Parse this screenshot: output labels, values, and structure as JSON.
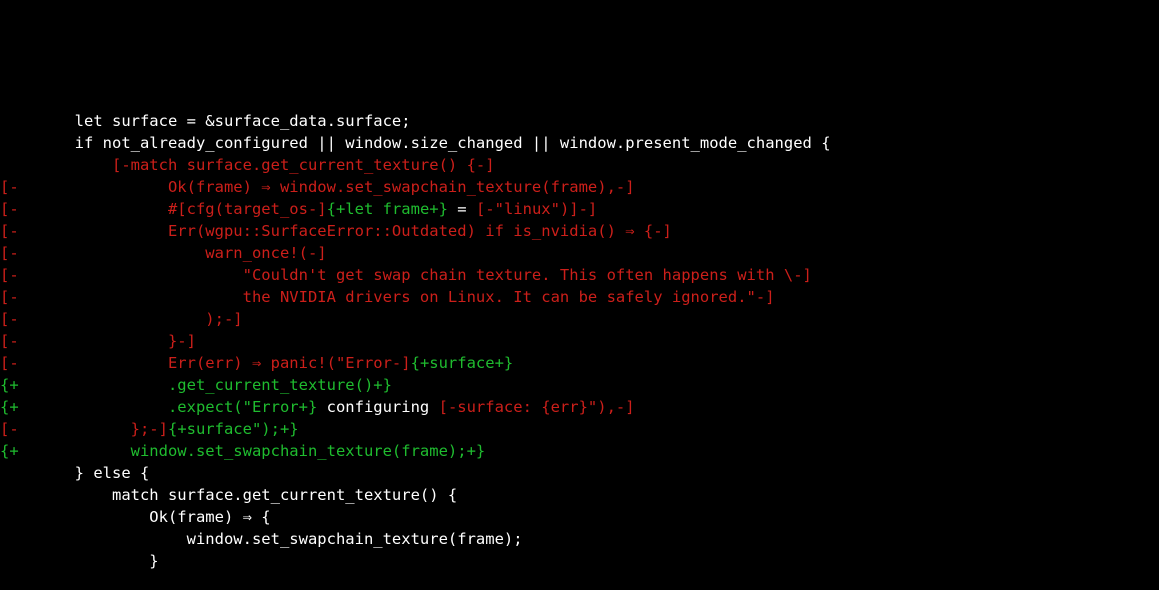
{
  "diff": {
    "lines": [
      {
        "segments": [
          {
            "cls": "ctx",
            "text": "        let surface = &surface_data.surface;"
          }
        ]
      },
      {
        "segments": [
          {
            "cls": "ctx",
            "text": "        if not_already_configured || window.size_changed || window.present_mode_changed {"
          }
        ]
      },
      {
        "segments": [
          {
            "cls": "ctx",
            "text": "            "
          },
          {
            "cls": "del",
            "text": "[-match surface.get_current_texture() {-]"
          }
        ]
      },
      {
        "segments": [
          {
            "cls": "del",
            "text": "[-                Ok(frame) ⇒ window.set_swapchain_texture(frame),-]"
          }
        ]
      },
      {
        "segments": [
          {
            "cls": "del",
            "text": "[-                #[cfg(target_os-]"
          },
          {
            "cls": "add",
            "text": "{+let frame+}"
          },
          {
            "cls": "ctx",
            "text": " = "
          },
          {
            "cls": "del",
            "text": "[-\"linux\")]-]"
          }
        ]
      },
      {
        "segments": [
          {
            "cls": "del",
            "text": "[-                Err(wgpu::SurfaceError::Outdated) if is_nvidia() ⇒ {-]"
          }
        ]
      },
      {
        "segments": [
          {
            "cls": "del",
            "text": "[-                    warn_once!(-]"
          }
        ]
      },
      {
        "segments": [
          {
            "cls": "del",
            "text": "[-                        \"Couldn't get swap chain texture. This often happens with \\-]"
          }
        ]
      },
      {
        "segments": [
          {
            "cls": "del",
            "text": "[-                        the NVIDIA drivers on Linux. It can be safely ignored.\"-]"
          }
        ]
      },
      {
        "segments": [
          {
            "cls": "del",
            "text": "[-                    );-]"
          }
        ]
      },
      {
        "segments": [
          {
            "cls": "del",
            "text": "[-                }-]"
          }
        ]
      },
      {
        "segments": [
          {
            "cls": "del",
            "text": "[-                Err(err) ⇒ panic!(\"Error-]"
          },
          {
            "cls": "add",
            "text": "{+surface+}"
          }
        ]
      },
      {
        "segments": [
          {
            "cls": "add",
            "text": "{+                .get_current_texture()+}"
          }
        ]
      },
      {
        "segments": [
          {
            "cls": "add",
            "text": "{+                .expect(\"Error+}"
          },
          {
            "cls": "ctx",
            "text": " configuring "
          },
          {
            "cls": "del",
            "text": "[-surface: {err}\"),-]"
          }
        ]
      },
      {
        "segments": [
          {
            "cls": "del",
            "text": "[-            };-]"
          },
          {
            "cls": "add",
            "text": "{+surface\");+}"
          }
        ]
      },
      {
        "segments": [
          {
            "cls": "add",
            "text": "{+            window.set_swapchain_texture(frame);+}"
          }
        ]
      },
      {
        "segments": [
          {
            "cls": "ctx",
            "text": "        } else {"
          }
        ]
      },
      {
        "segments": [
          {
            "cls": "ctx",
            "text": "            match surface.get_current_texture() {"
          }
        ]
      },
      {
        "segments": [
          {
            "cls": "ctx",
            "text": "                Ok(frame) ⇒ {"
          }
        ]
      },
      {
        "segments": [
          {
            "cls": "ctx",
            "text": "                    window.set_swapchain_texture(frame);"
          }
        ]
      },
      {
        "segments": [
          {
            "cls": "ctx",
            "text": "                }"
          }
        ]
      }
    ]
  }
}
